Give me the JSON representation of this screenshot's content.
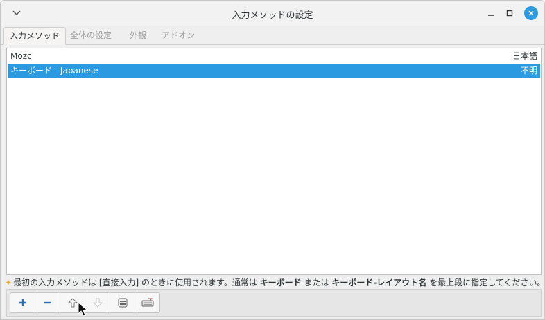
{
  "window": {
    "title": "入力メソッドの設定"
  },
  "tabs": [
    {
      "label": "入力メソッド"
    },
    {
      "label": "全体の設定"
    },
    {
      "label": "外観"
    },
    {
      "label": "アドオン"
    }
  ],
  "list": {
    "group_header": {
      "name": "Mozc",
      "language": "日本語"
    },
    "rows": [
      {
        "name": "キーボード - Japanese",
        "language": "不明",
        "selected": true
      }
    ]
  },
  "hint": {
    "part1": "最初の入力メソッドは [直接入力] のときに使用されます。通常は ",
    "bold1": "キーボード",
    "part2": " または ",
    "bold2": "キーボード-レイアウト名",
    "part3": " を最上段に指定してください。"
  },
  "toolbar": {
    "buttons": [
      {
        "icon": "add-icon",
        "enabled": true
      },
      {
        "icon": "remove-icon",
        "enabled": true
      },
      {
        "icon": "move-up-icon",
        "enabled": true
      },
      {
        "icon": "move-down-icon",
        "enabled": false
      },
      {
        "icon": "configure-icon",
        "enabled": true
      },
      {
        "icon": "keyboard-layout-icon",
        "enabled": true
      }
    ]
  },
  "colors": {
    "accent": "#2b9ae0",
    "close_button": "#2a9be0",
    "hint_star": "#e0b030"
  }
}
